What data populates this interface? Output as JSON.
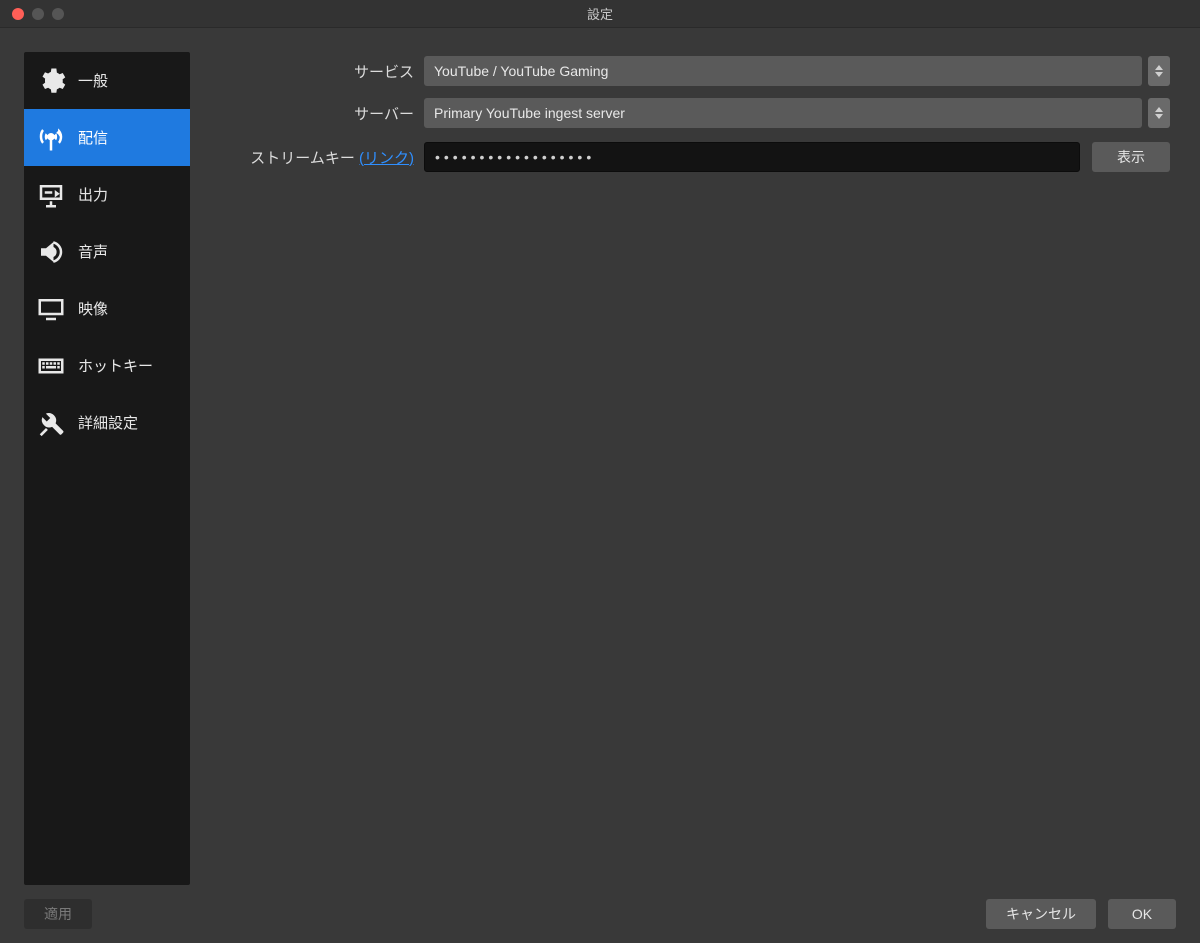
{
  "window": {
    "title": "設定"
  },
  "sidebar": {
    "items": [
      {
        "label": "一般"
      },
      {
        "label": "配信"
      },
      {
        "label": "出力"
      },
      {
        "label": "音声"
      },
      {
        "label": "映像"
      },
      {
        "label": "ホットキー"
      },
      {
        "label": "詳細設定"
      }
    ],
    "active_index": 1
  },
  "form": {
    "service_label": "サービス",
    "service_value": "YouTube / YouTube Gaming",
    "server_label": "サーバー",
    "server_value": "Primary YouTube ingest server",
    "streamkey_label_prefix": "ストリームキー ",
    "streamkey_link_text": "(リンク)",
    "streamkey_value_mask": "••••••••••••••••••",
    "show_button": "表示"
  },
  "footer": {
    "apply": "適用",
    "cancel": "キャンセル",
    "ok": "OK"
  }
}
